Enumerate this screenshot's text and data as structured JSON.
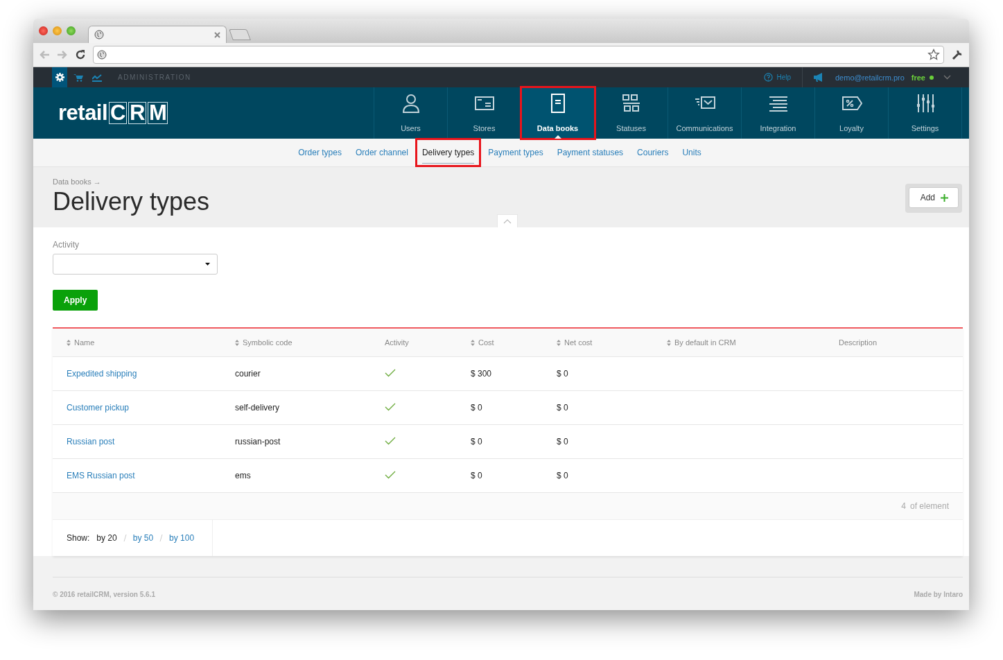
{
  "admin_bar": {
    "label": "ADMINISTRATION",
    "help": "Help",
    "user": "demo@retailcrm.pro",
    "plan": "free"
  },
  "logo": {
    "prefix": "retail",
    "suffix": "CRM"
  },
  "nav": [
    {
      "label": "Users",
      "kind": "user",
      "selected": false,
      "highlighted": false
    },
    {
      "label": "Stores",
      "kind": "store",
      "selected": false,
      "highlighted": false
    },
    {
      "label": "Data books",
      "kind": "book",
      "selected": true,
      "highlighted": true
    },
    {
      "label": "Statuses",
      "kind": "statuses",
      "selected": false,
      "highlighted": false
    },
    {
      "label": "Communications",
      "kind": "communications",
      "selected": false,
      "highlighted": false
    },
    {
      "label": "Integration",
      "kind": "integration",
      "selected": false,
      "highlighted": false
    },
    {
      "label": "Loyalty",
      "kind": "loyalty",
      "selected": false,
      "highlighted": false
    },
    {
      "label": "Settings",
      "kind": "settings",
      "selected": false,
      "highlighted": false
    }
  ],
  "subnav": [
    {
      "label": "Order types",
      "selected": false,
      "highlighted": false
    },
    {
      "label": "Order channel",
      "selected": false,
      "highlighted": false
    },
    {
      "label": "Delivery types",
      "selected": true,
      "highlighted": true
    },
    {
      "label": "Payment types",
      "selected": false,
      "highlighted": false
    },
    {
      "label": "Payment statuses",
      "selected": false,
      "highlighted": false
    },
    {
      "label": "Couriers",
      "selected": false,
      "highlighted": false
    },
    {
      "label": "Units",
      "selected": false,
      "highlighted": false
    }
  ],
  "breadcrumb": "Data books →",
  "title": "Delivery types",
  "add_button": "Add",
  "filter": {
    "label": "Activity",
    "apply": "Apply"
  },
  "table": {
    "columns": [
      {
        "label": "Name",
        "sortable": true
      },
      {
        "label": "Symbolic code",
        "sortable": true
      },
      {
        "label": "Activity",
        "sortable": false
      },
      {
        "label": "Cost",
        "sortable": true
      },
      {
        "label": "Net cost",
        "sortable": true
      },
      {
        "label": "By default in CRM",
        "sortable": true
      },
      {
        "label": "Description",
        "sortable": false
      }
    ],
    "rows": [
      {
        "name": "Expedited shipping",
        "code": "courier",
        "active": true,
        "cost": "$ 300",
        "net_cost": "$ 0"
      },
      {
        "name": "Customer pickup",
        "code": "self-delivery",
        "active": true,
        "cost": "$ 0",
        "net_cost": "$ 0"
      },
      {
        "name": "Russian post",
        "code": "russian-post",
        "active": true,
        "cost": "$ 0",
        "net_cost": "$ 0"
      },
      {
        "name": "EMS Russian post",
        "code": "ems",
        "active": true,
        "cost": "$ 0",
        "net_cost": "$ 0"
      }
    ]
  },
  "count": "4",
  "count_label": "of element",
  "pagination": {
    "label": "Show:",
    "options": [
      {
        "label": "by 20",
        "selected": true
      },
      {
        "label": "by 50",
        "selected": false
      },
      {
        "label": "by 100",
        "selected": false
      }
    ]
  },
  "footer": {
    "copyright": "© 2016 retailCRM, version 5.6.1",
    "credit": "Made by Intaro"
  }
}
